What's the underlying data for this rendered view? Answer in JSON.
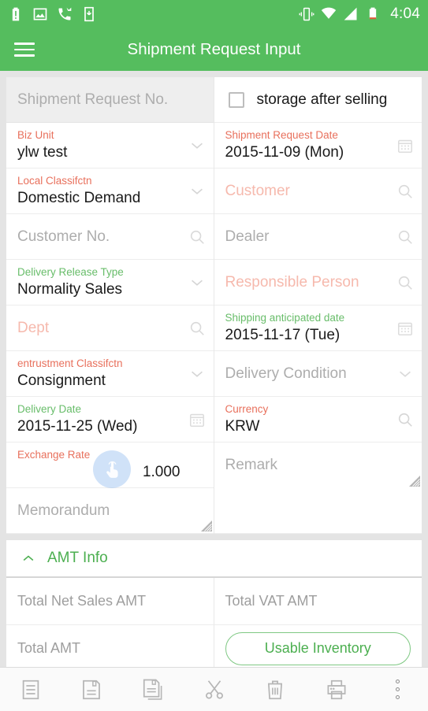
{
  "status_bar": {
    "icons": [
      "battery-alert-icon",
      "image-icon",
      "call-missed-icon",
      "download-icon"
    ],
    "right_icons": [
      "vibrate-icon",
      "wifi-icon",
      "signal-icon",
      "battery-icon"
    ],
    "time": "4:04"
  },
  "app_bar": {
    "menu_icon": "hamburger-menu-icon",
    "title": "Shipment Request Input"
  },
  "form": {
    "shipment_request_no": {
      "placeholder": "Shipment Request No.",
      "value": ""
    },
    "storage_after_selling": {
      "label": "storage after selling",
      "checked": false
    },
    "biz_unit": {
      "label": "Biz Unit",
      "value": "ylw test",
      "icon": "chevron-down-icon",
      "required": true
    },
    "shipment_request_date": {
      "label": "Shipment Request Date",
      "value": "2015-11-09 (Mon)",
      "icon": "calendar-icon",
      "required": true
    },
    "local_classifctn": {
      "label": "Local Classifctn",
      "value": "Domestic Demand",
      "icon": "chevron-down-icon",
      "required": true
    },
    "customer": {
      "placeholder": "Customer",
      "value": "",
      "icon": "search-icon",
      "required": true
    },
    "customer_no": {
      "placeholder": "Customer No.",
      "value": "",
      "icon": "search-icon",
      "required": false
    },
    "dealer": {
      "placeholder": "Dealer",
      "value": "",
      "icon": "search-icon",
      "required": false
    },
    "delivery_release_type": {
      "label": "Delivery Release Type",
      "value": "Normality Sales",
      "icon": "chevron-down-icon",
      "required": false
    },
    "responsible_person": {
      "placeholder": "Responsible Person",
      "value": "",
      "icon": "search-icon",
      "required": true
    },
    "dept": {
      "placeholder": "Dept",
      "value": "",
      "icon": "search-icon",
      "required": true
    },
    "shipping_anticipated_date": {
      "label": "Shipping anticipated date",
      "value": "2015-11-17 (Tue)",
      "icon": "calendar-icon",
      "required": false
    },
    "entrustment_classifctn": {
      "label": "entrustment Classifctn",
      "value": "Consignment",
      "icon": "chevron-down-icon",
      "required": true
    },
    "delivery_condition": {
      "placeholder": "Delivery Condition",
      "value": "",
      "icon": "chevron-down-icon",
      "required": false
    },
    "delivery_date": {
      "label": "Delivery Date",
      "value": "2015-11-25 (Wed)",
      "icon": "calendar-icon",
      "required": false
    },
    "currency": {
      "label": "Currency",
      "value": "KRW",
      "icon": "search-icon",
      "required": true
    },
    "exchange_rate": {
      "label": "Exchange Rate",
      "value": "1.000",
      "required": true
    },
    "remark": {
      "placeholder": "Remark",
      "value": "",
      "resize_handle": "resize-grip-icon"
    },
    "memorandum": {
      "placeholder": "Memorandum",
      "value": "",
      "resize_handle": "resize-grip-icon"
    }
  },
  "amt_info": {
    "collapse_icon": "chevron-up-icon",
    "title": "AMT Info",
    "rows": [
      {
        "left_label": "Total Net Sales AMT",
        "right_label": "Total VAT AMT"
      },
      {
        "left_label": "Total AMT",
        "right_button": "Usable Inventory"
      }
    ]
  },
  "toolbar": {
    "buttons": [
      {
        "name": "list-icon",
        "label": "List"
      },
      {
        "name": "save-icon",
        "label": "Save"
      },
      {
        "name": "save-as-icon",
        "label": "Save As"
      },
      {
        "name": "cut-icon",
        "label": "Cut"
      },
      {
        "name": "delete-icon",
        "label": "Delete"
      },
      {
        "name": "print-icon",
        "label": "Print"
      },
      {
        "name": "overflow-menu-icon",
        "label": "More"
      }
    ]
  },
  "touch_indicator": {
    "icon": "tap-gesture-icon"
  },
  "colors": {
    "brand_green": "#55bd5e",
    "label_required": "#e8705c",
    "label_valid": "#68bd6a",
    "accent_green": "#4caf50",
    "placeholder_gray": "#adadad",
    "placeholder_required": "#f6b9ad"
  }
}
